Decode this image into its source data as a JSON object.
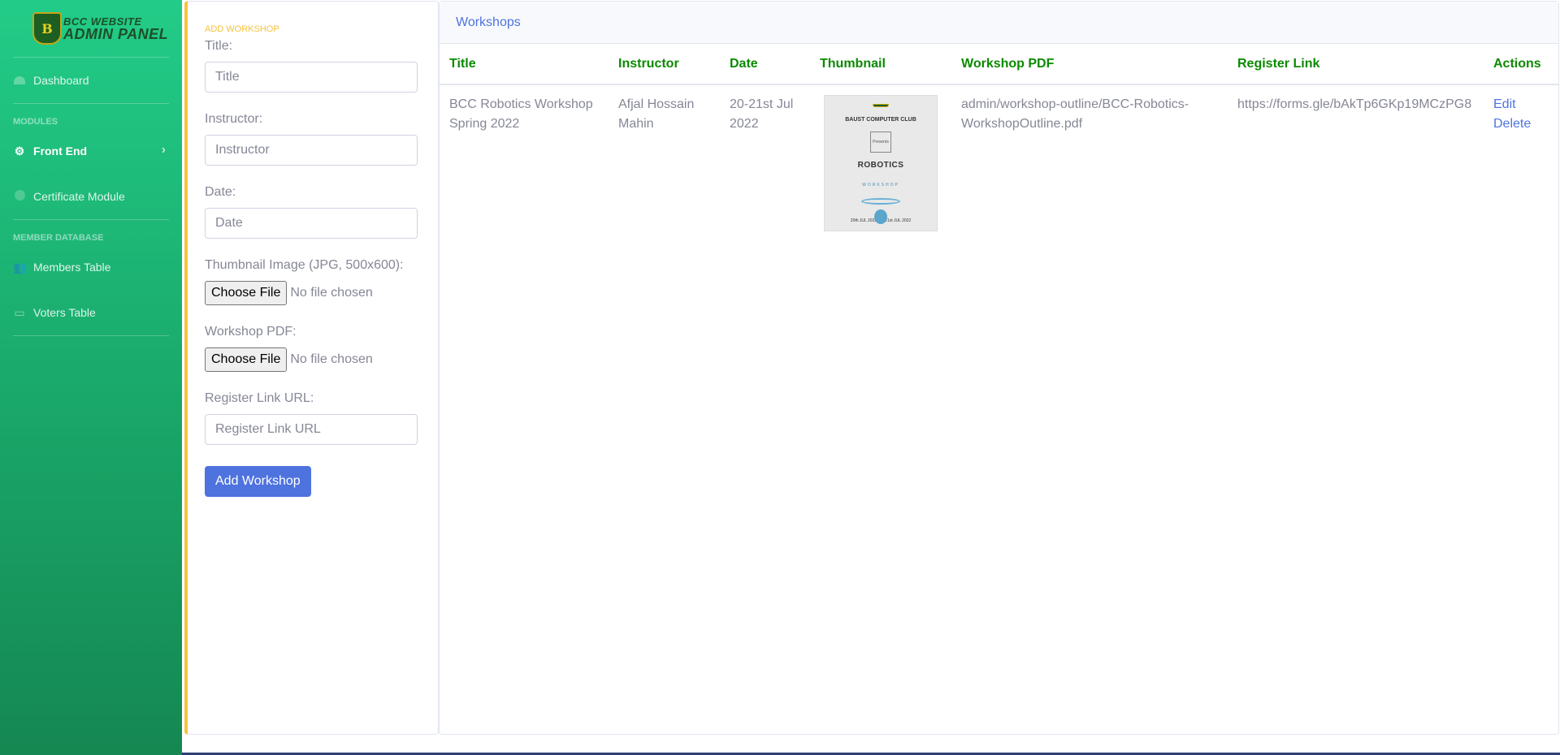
{
  "sidebar": {
    "brand": {
      "line1": "BCC WEBSITE",
      "line2": "ADMIN PANEL",
      "logo_letter": "B"
    },
    "dashboard_label": "Dashboard",
    "modules_heading": "MODULES",
    "frontend_label": "Front End",
    "certificate_label": "Certificate Module",
    "member_db_heading": "MEMBER DATABASE",
    "members_label": "Members Table",
    "voters_label": "Voters Table",
    "icons": {
      "dashboard": "tachometer-icon",
      "frontend": "gear-icon",
      "certificate": "circle-icon",
      "members": "users-icon",
      "voters": "vote-box-icon",
      "chevron": "chevron-right-icon"
    }
  },
  "form": {
    "title": "ADD WORKSHOP",
    "title_label": "Title:",
    "title_placeholder": "Title",
    "instructor_label": "Instructor:",
    "instructor_placeholder": "Instructor",
    "date_label": "Date:",
    "date_placeholder": "Date",
    "thumb_label": "Thumbnail Image (JPG, 500x600):",
    "pdf_label": "Workshop PDF:",
    "choose_file": "Choose File",
    "no_file": "No file chosen",
    "register_label": "Register Link URL:",
    "register_placeholder": "Register Link URL",
    "submit_label": "Add Workshop"
  },
  "table": {
    "heading": "Workshops",
    "columns": [
      "Title",
      "Instructor",
      "Date",
      "Thumbnail",
      "Workshop PDF",
      "Register Link",
      "Actions"
    ],
    "rows": [
      {
        "title": "BCC Robotics Workshop Spring 2022",
        "instructor": "Afjal Hossain Mahin",
        "date": "20-21st Jul 2022",
        "thumbnail": {
          "club": "BAUST COMPUTER CLUB",
          "presents": "Presents",
          "name": "ROBOTICS",
          "sub": "WORKSHOP",
          "day1": "20th JUL 2022",
          "day2": "21st JUL 2022"
        },
        "pdf": "admin/workshop-outline/BCC-Robotics-WorkshopOutline.pdf",
        "register_link": "https://forms.gle/bAkTp6GKp19MCzPG8",
        "edit_label": "Edit",
        "delete_label": "Delete"
      }
    ]
  },
  "colors": {
    "sidebar_top": "#22cc88",
    "sidebar_bottom": "#158752",
    "accent_blue": "#4e73df",
    "accent_yellow": "#f6c23e",
    "header_green": "#0b8a00"
  }
}
